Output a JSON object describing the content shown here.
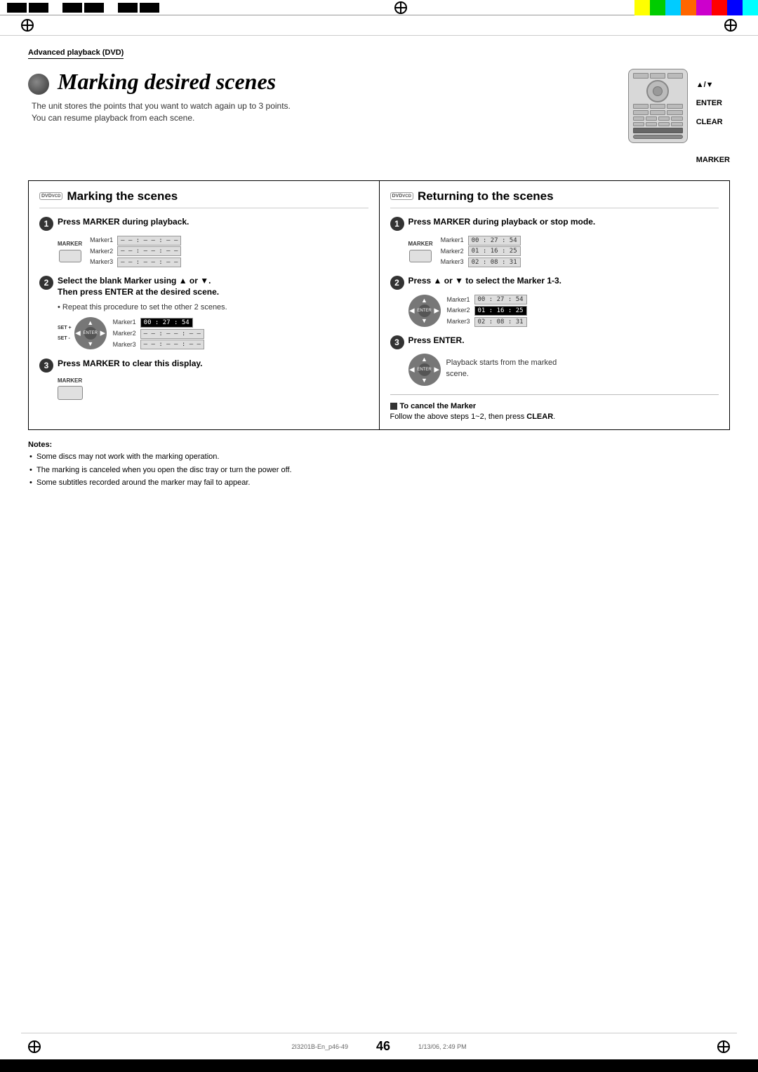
{
  "page": {
    "number": "46",
    "footer_left": "2I3201B-En_p46-49",
    "footer_center": "46",
    "footer_right": "1/13/06, 2:49 PM"
  },
  "header": {
    "section": "Advanced playback (DVD)"
  },
  "title": {
    "main": "Marking desired scenes",
    "subtitle_line1": "The unit stores the points that you want to watch again up to 3 points.",
    "subtitle_line2": "You can resume playback from each scene."
  },
  "remote_labels": {
    "arrow": "▲/▼",
    "enter": "ENTER",
    "clear": "CLEAR",
    "marker": "MARKER"
  },
  "marking_section": {
    "title": "Marking the scenes",
    "dvd_badge": "DVD\nVCD",
    "steps": [
      {
        "num": "1",
        "instruction": "Press MARKER during playback.",
        "has_marker_display": true,
        "marker_label": "MARKER",
        "markers": [
          {
            "label": "Marker1",
            "time": "— — : — — : — —"
          },
          {
            "label": "Marker2",
            "time": "— — : — — : — —"
          },
          {
            "label": "Marker3",
            "time": "— — : — — : — —"
          }
        ]
      },
      {
        "num": "2",
        "instruction_line1": "Select the blank Marker using ▲ or ▼.",
        "instruction_line2": "Then press ENTER at the desired scene.",
        "sub_note": "Repeat this procedure to set the other 2 scenes.",
        "markers_after": [
          {
            "label": "Marker1",
            "time": "00 : 27 : 54",
            "highlight": true
          },
          {
            "label": "Marker2",
            "time": "— — : — — : — —"
          },
          {
            "label": "Marker3",
            "time": "— — : — — : — —"
          }
        ]
      },
      {
        "num": "3",
        "instruction": "Press MARKER to clear this display.",
        "has_marker_btn": true,
        "marker_label": "MARKER"
      }
    ]
  },
  "returning_section": {
    "title": "Returning to the scenes",
    "dvd_badge": "DVD\nVCD",
    "steps": [
      {
        "num": "1",
        "instruction": "Press MARKER during playback or stop mode.",
        "marker_label": "MARKER",
        "markers": [
          {
            "label": "Marker1",
            "time": "00 : 27 : 54"
          },
          {
            "label": "Marker2",
            "time": "01 : 16 : 25"
          },
          {
            "label": "Marker3",
            "time": "02 : 08 : 31"
          }
        ]
      },
      {
        "num": "2",
        "instruction": "Press ▲ or ▼ to select the Marker 1-3.",
        "markers": [
          {
            "label": "Marker1",
            "time": "00 : 27 : 54"
          },
          {
            "label": "Marker2",
            "time": "01 : 16 : 25",
            "highlight": true
          },
          {
            "label": "Marker3",
            "time": "02 : 08 : 31"
          }
        ]
      },
      {
        "num": "3",
        "instruction": "Press ENTER.",
        "sub_note_line1": "Playback starts from the marked",
        "sub_note_line2": "scene."
      }
    ],
    "cancel_title": "To cancel the Marker",
    "cancel_text": "Follow the above steps 1~2, then press ",
    "cancel_bold": "CLEAR",
    "cancel_period": "."
  },
  "notes": {
    "title": "Notes:",
    "items": [
      "Some discs may not work with the marking operation.",
      "The marking is canceled when you open the disc tray or turn the power off.",
      "Some subtitles recorded around the marker may fail to appear."
    ]
  },
  "colors": {
    "black": "#000000",
    "white": "#ffffff",
    "highlight_time": "#000000",
    "highlight_text": "#ffffff",
    "section_bg": "#f5f5f5",
    "color_strip": [
      "#ffff00",
      "#00cc00",
      "#00ccff",
      "#ff6600",
      "#cc00cc",
      "#ff0000",
      "#0000ff",
      "#00ffff"
    ]
  }
}
